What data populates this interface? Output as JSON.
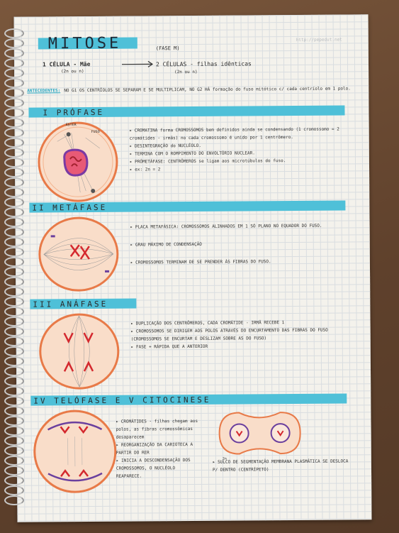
{
  "title": "MITOSE",
  "title_note": "(FASE M)",
  "watermark": "http://pepedut.net",
  "summary": {
    "left": "1 CÉLULA - Mãe",
    "left_sub": "(2n ou n)",
    "right": "2 CÉLULAS - filhas idênticas",
    "right_sub": "(2n ou n)"
  },
  "antecedentes": {
    "label": "ANTECEDENTES:",
    "text": "NO G1 OS CENTRÍOLOS SE SEPARAM E SE MULTIPLICAM, NO G2 HÁ formação do fuso mitótico c/ cada centríolo em 1 polo."
  },
  "sections": {
    "prophase": {
      "heading": "I PRÓFASE",
      "labels": [
        "ÁSTER",
        "FUSO"
      ],
      "lines": [
        "▸ CROMATINA forma CROMOSSOMOS bem definidos ainda se condensando (1 cromossomo = 2 cromátides - irmãs) no cada cromossomo é unido por 1 centrômero.",
        "▸ DESINTEGRAÇÃO do NUCLÉOLO.",
        "▸ TERMINA COM O ROMPIMENTO DO ENVOLTÓRIO NUCLEAR.",
        "▸ PRÓMETÁFASE: CENTRÔMEROS se ligam aos microtúbulos do fuso.",
        "▸ ex: 2n = 2"
      ]
    },
    "metaphase": {
      "heading": "II METÁFASE",
      "lines": [
        "▸ PLACA METAFÁSICA: CROMOSSOMOS ALINHADOS EM 1 SÓ PLANO NO EQUADOR DO FUSO.",
        "▸ GRAU MÁXIMO DE CONDENSAÇÃO",
        "▸ CROMOSSOMOS TERMINAM DE SE PRENDER ÀS FIBRAS DO FUSO."
      ]
    },
    "anaphase": {
      "heading": "III ANÁFASE",
      "lines": [
        "▸ DUPLICAÇÃO DOS CENTRÔMEROS, CADA CROMÁTIDE - IRMÃ RECEBE 1",
        "▸ CROMOSSOMOS SE DIRIGEM AOS POLOS ATRAVÉS DO ENCURTAMENTO DAS FIBRAS DO FUSO (CROMOSSOMOS SE ENCURTAM E DESLIZAM SOBRE AS DO FUSO)",
        "▸ FASE + RÁPIDA QUE A ANTERIOR"
      ]
    },
    "telophase": {
      "heading": "IV TELÓFASE E V CITOCINESE",
      "lines": [
        "▸ CROMÁTIDES - filhas chegam aos polos, as fibras cromossômicas desaparecem",
        "▸ REORGANIZAÇÃO DA CARIOTECA A PARTIR DO RER",
        "▸ INICIA A DESCONDENSAÇÃO DOS CROMOSSOMOS, O NUCLÉOLO REAPARECE."
      ],
      "cyto_label": "2n",
      "cyto_text": "▸ SULCO DE SEGMENTAÇÃO MEMBRANA PLASMÁTICA SE DESLOCA P/ DENTRO (CENTRÍPETO)"
    }
  }
}
